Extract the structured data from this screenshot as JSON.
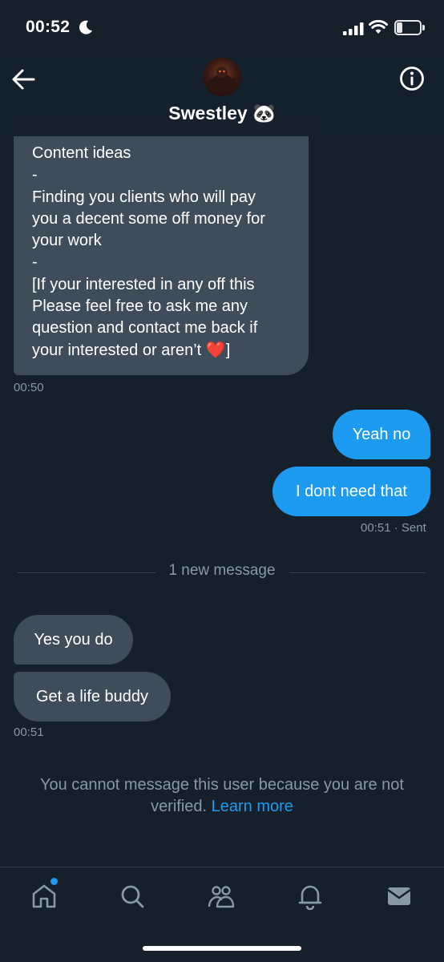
{
  "status_bar": {
    "time": "00:52",
    "battery_level": "25",
    "icons": [
      "moon-icon",
      "signal-icon",
      "wifi-icon",
      "battery-icon"
    ]
  },
  "header": {
    "contact_name": "Swestley 🐼",
    "icons": [
      "back-arrow-icon",
      "info-icon"
    ]
  },
  "messages": {
    "long_message_lines": [
      "Content ideas",
      "-",
      "Finding you clients who will pay",
      "you a decent some off money for",
      "your work",
      "-",
      "[If your interested in any off this",
      "Please feel free to ask me any",
      "question and contact me back if",
      "your interested or aren’t "
    ],
    "long_message_end": "❤️",
    "long_message_close": "]",
    "long_message_time": "00:50",
    "outgoing_1": "Yeah no",
    "outgoing_2": "I dont need that",
    "outgoing_time": "00:51",
    "outgoing_status": "· Sent",
    "divider": "1 new message",
    "incoming_1": "Yes you do",
    "incoming_2": "Get a life buddy",
    "incoming_time": "00:51"
  },
  "notice": {
    "text": "You cannot message this user because you are not verified. ",
    "link": "Learn more"
  },
  "bottom_nav": {
    "items": [
      "home-icon",
      "search-icon",
      "communities-icon",
      "notifications-icon",
      "messages-icon"
    ]
  },
  "colors": {
    "background": "#15202b",
    "incoming_bubble": "#3f4d5b",
    "outgoing_bubble": "#1d9bf0",
    "muted_text": "#8899a6",
    "accent": "#1d9bf0"
  }
}
